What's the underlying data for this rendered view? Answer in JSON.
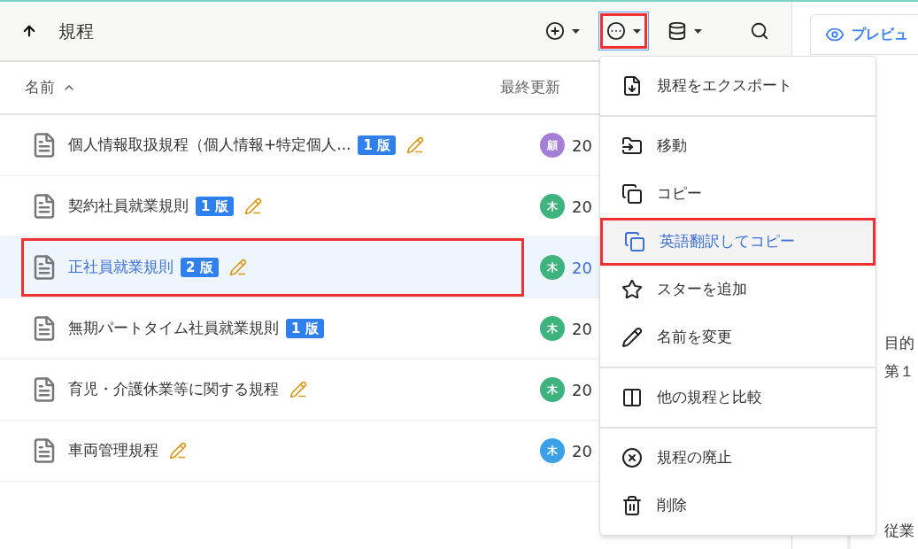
{
  "toolbar": {
    "title": "規程",
    "buttons": [
      {
        "kind": "add",
        "selected": false,
        "annotated": false
      },
      {
        "kind": "more",
        "selected": true,
        "annotated": true
      },
      {
        "kind": "database",
        "selected": false,
        "annotated": false
      },
      {
        "kind": "search",
        "selected": false,
        "annotated": false
      }
    ]
  },
  "table": {
    "columns": [
      {
        "label": "名前",
        "sorted": true
      },
      {
        "label": "最終更新"
      }
    ],
    "rows": [
      {
        "name": "個人情報取扱規程（個人情報+特定個人...",
        "badge": "1 版",
        "editing": true,
        "selected": false,
        "annotated": false,
        "avatar": "顧",
        "color": "#a57fd6",
        "date": "20"
      },
      {
        "name": "契約社員就業規則",
        "badge": "1 版",
        "editing": true,
        "selected": false,
        "annotated": false,
        "avatar": "木",
        "color": "#3fb37d",
        "date": "20"
      },
      {
        "name": "正社員就業規則",
        "badge": "2 版",
        "editing": true,
        "selected": true,
        "annotated": true,
        "avatar": "木",
        "color": "#3fb37d",
        "date": "20"
      },
      {
        "name": "無期パートタイム社員就業規則",
        "badge": "1 版",
        "editing": false,
        "selected": false,
        "annotated": false,
        "avatar": "木",
        "color": "#3fb37d",
        "date": "20"
      },
      {
        "name": "育児・介護休業等に関する規程",
        "editing": true,
        "selected": false,
        "annotated": false,
        "avatar": "木",
        "color": "#3fb37d",
        "date": "20"
      },
      {
        "name": "車両管理規程",
        "editing": true,
        "selected": false,
        "annotated": false,
        "avatar": "木",
        "color": "#3aa0e8",
        "date": "20"
      }
    ]
  },
  "preview": {
    "tab": "プレビュ",
    "lines": [
      "目的",
      "第１",
      "従業"
    ]
  },
  "menu": {
    "items": [
      {
        "kind": "export",
        "label": "規程をエクスポート",
        "selected": false,
        "annotated": false,
        "divider_after": true
      },
      {
        "kind": "move",
        "label": "移動",
        "selected": false,
        "annotated": false,
        "divider_after": false
      },
      {
        "kind": "copy",
        "label": "コピー",
        "selected": false,
        "annotated": false,
        "divider_after": false
      },
      {
        "kind": "copy",
        "label": "英語翻訳してコピー",
        "selected": true,
        "annotated": true,
        "divider_after": false
      },
      {
        "kind": "star",
        "label": "スターを追加",
        "selected": false,
        "annotated": false,
        "divider_after": false
      },
      {
        "kind": "rename",
        "label": "名前を変更",
        "selected": false,
        "annotated": false,
        "divider_after": true
      },
      {
        "kind": "compare",
        "label": "他の規程と比較",
        "selected": false,
        "annotated": false,
        "divider_after": true
      },
      {
        "kind": "abolish",
        "label": "規程の廃止",
        "selected": false,
        "annotated": false,
        "divider_after": false
      },
      {
        "kind": "delete",
        "label": "削除",
        "selected": false,
        "annotated": false,
        "divider_after": false
      }
    ]
  }
}
